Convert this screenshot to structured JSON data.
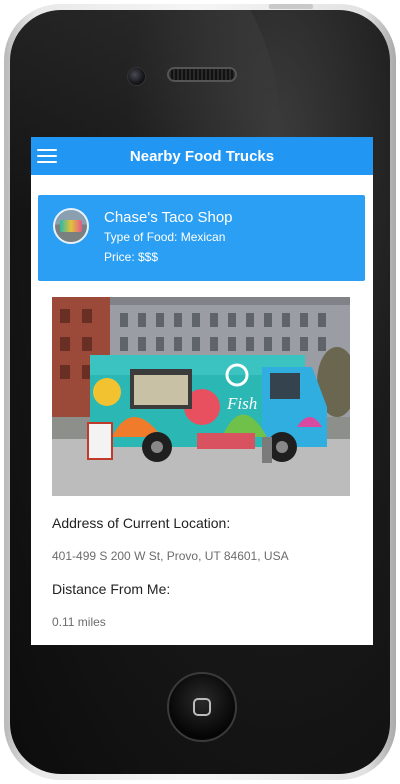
{
  "app": {
    "title": "Nearby Food Trucks",
    "accent_color": "#2196f3",
    "menu_icon": "hamburger-menu-icon"
  },
  "truck": {
    "name": "Chase's Taco Shop",
    "type_of_food": "Type of Food: Mexican",
    "price": "Price: $$$",
    "image_sign_text": "Fish"
  },
  "details": {
    "address_label": "Address of Current Location:",
    "address_value": "401-499 S 200 W St, Provo, UT 84601, USA",
    "distance_label": "Distance From Me:",
    "distance_value": "0.11 miles"
  }
}
